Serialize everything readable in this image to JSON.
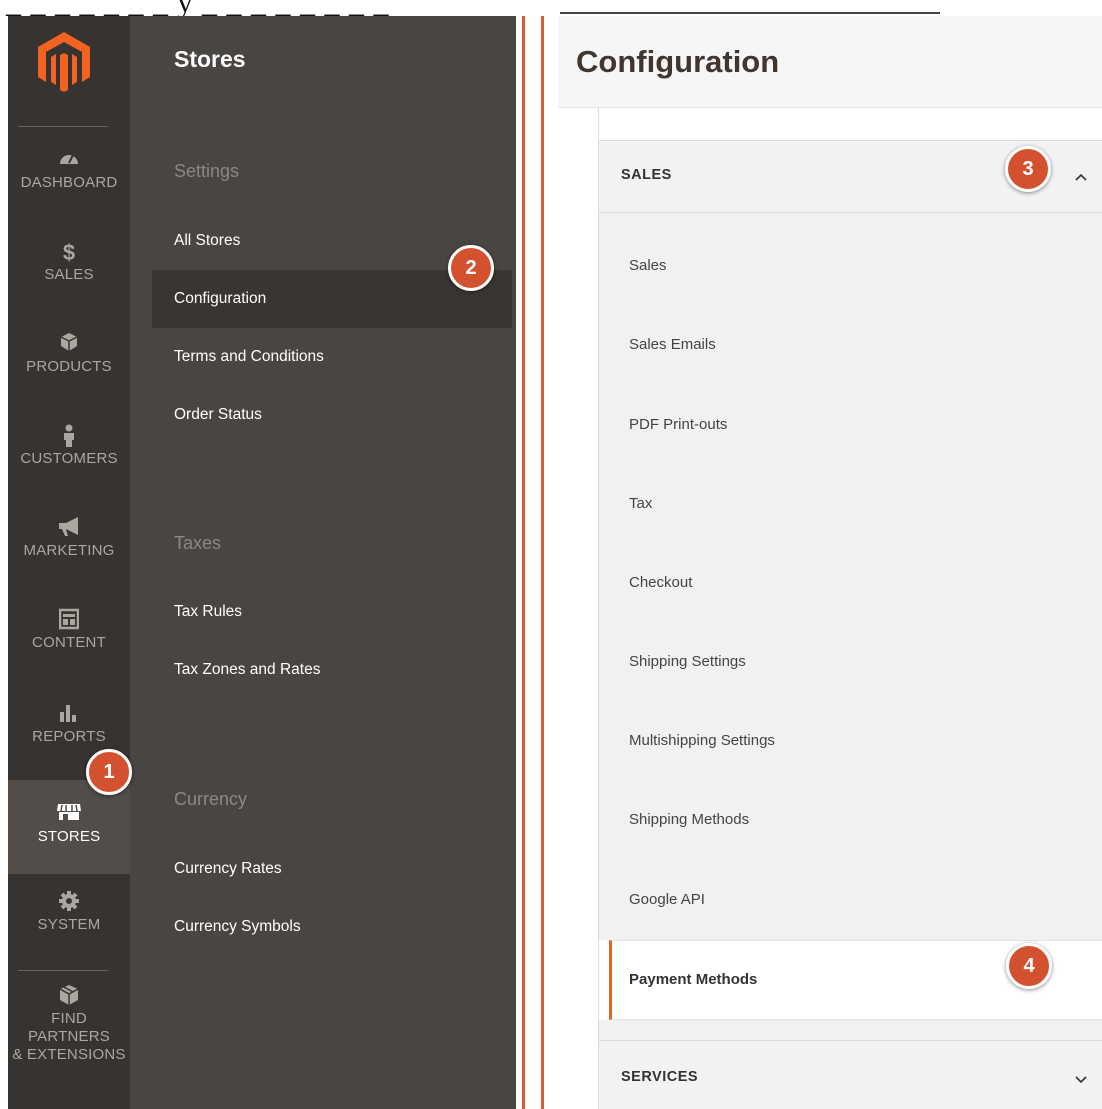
{
  "page": {
    "title": "Configuration",
    "top_strip_text": "_ _ _ _ _ _ _ y _ _ _ _ _ _ _ _"
  },
  "admin_menu": {
    "items": [
      {
        "label": "DASHBOARD",
        "icon": "dashboard-gauge-icon"
      },
      {
        "label": "SALES",
        "icon": "dollar-icon"
      },
      {
        "label": "PRODUCTS",
        "icon": "cube-icon"
      },
      {
        "label": "CUSTOMERS",
        "icon": "person-icon"
      },
      {
        "label": "MARKETING",
        "icon": "megaphone-icon"
      },
      {
        "label": "CONTENT",
        "icon": "layout-icon"
      },
      {
        "label": "REPORTS",
        "icon": "bar-chart-icon"
      },
      {
        "label": "STORES",
        "icon": "storefront-icon",
        "active": true
      },
      {
        "label": "SYSTEM",
        "icon": "gear-icon"
      },
      {
        "label": "FIND PARTNERS",
        "label2": "& EXTENSIONS",
        "icon": "partners-box-icon"
      }
    ]
  },
  "flyout": {
    "title": "Stores",
    "sections": [
      {
        "heading": "Settings",
        "links": [
          "All Stores",
          "Configuration",
          "Terms and Conditions",
          "Order Status"
        ]
      },
      {
        "heading": "Taxes",
        "links": [
          "Tax Rules",
          "Tax Zones and Rates"
        ]
      },
      {
        "heading": "Currency",
        "links": [
          "Currency Rates",
          "Currency Symbols"
        ]
      }
    ],
    "active_link": "Configuration"
  },
  "config": {
    "sales_tab": {
      "title": "SALES",
      "expanded": true,
      "items": [
        "Sales",
        "Sales Emails",
        "PDF Print-outs",
        "Tax",
        "Checkout",
        "Shipping Settings",
        "Multishipping Settings",
        "Shipping Methods",
        "Google API",
        "Payment Methods"
      ],
      "active_item": "Payment Methods"
    },
    "services_tab": {
      "title": "SERVICES",
      "expanded": false
    }
  },
  "markers": [
    "1",
    "2",
    "3",
    "4"
  ],
  "colors": {
    "menu_bg": "#373330",
    "flyout_bg": "#4a4542",
    "accent": "#e7641f",
    "marker": "#d4512f",
    "logo": "#f26322"
  }
}
